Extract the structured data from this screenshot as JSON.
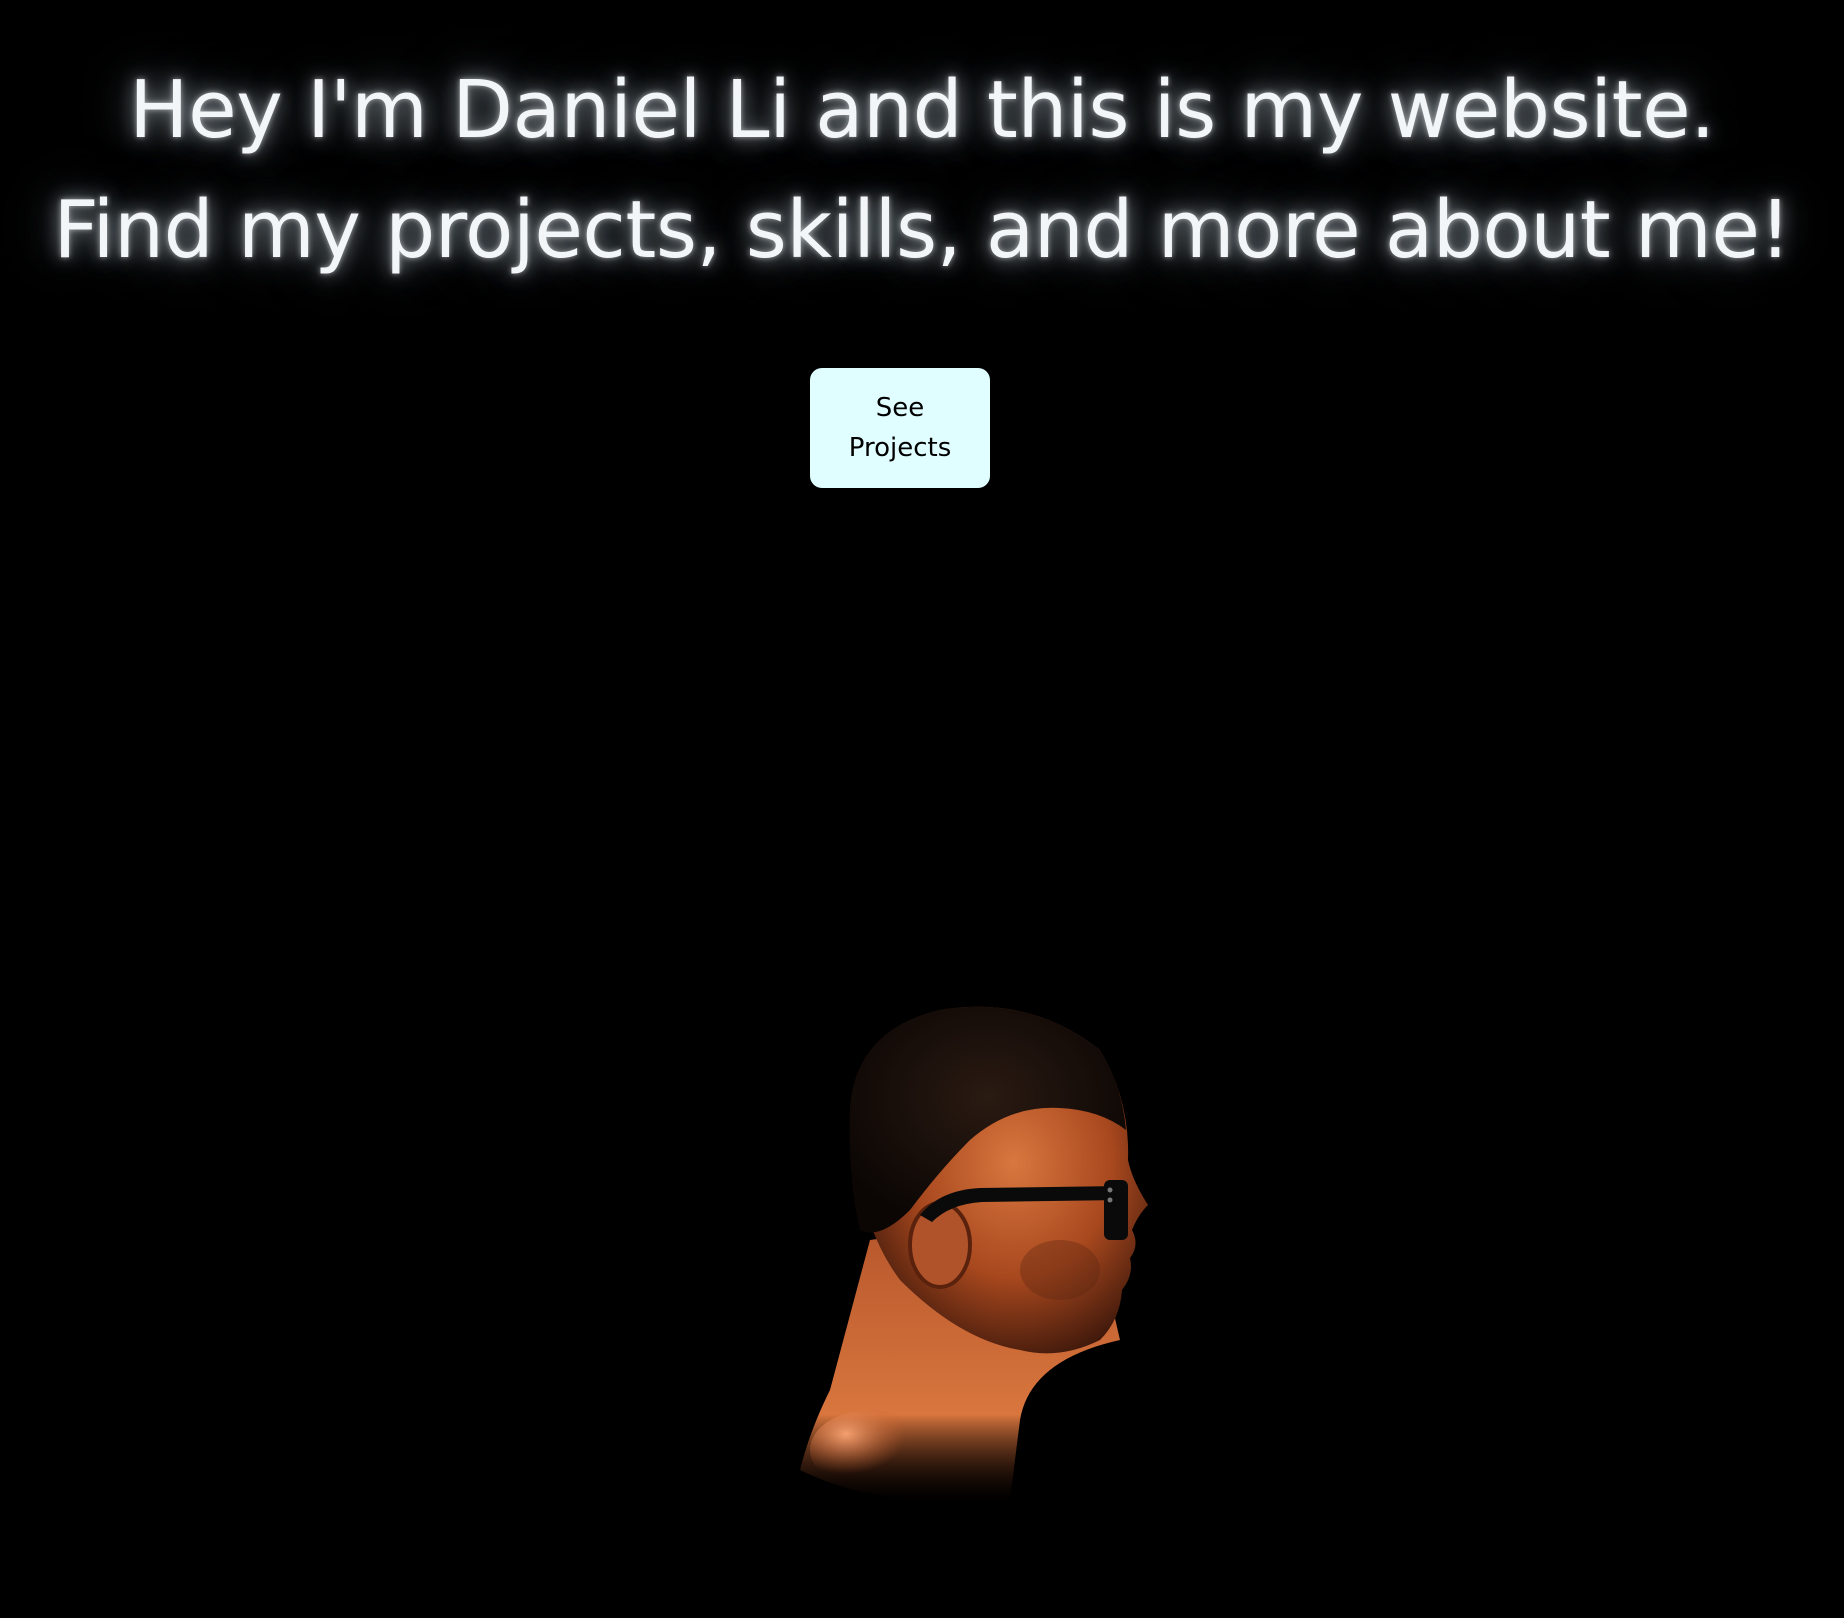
{
  "hero": {
    "headline_line1": "Hey I'm Daniel Li and this is my website.",
    "headline_line2": "Find my projects, skills, and more about me!",
    "cta_label": "See Projects"
  },
  "colors": {
    "background": "#000000",
    "headline_text": "#f2f6f8",
    "headline_glow": "#c8dceb",
    "button_background": "#e0fdff",
    "button_text": "#000000",
    "portrait_skin": "#c8602e"
  },
  "portrait": {
    "description_icon": "profile-portrait-3d-model"
  }
}
